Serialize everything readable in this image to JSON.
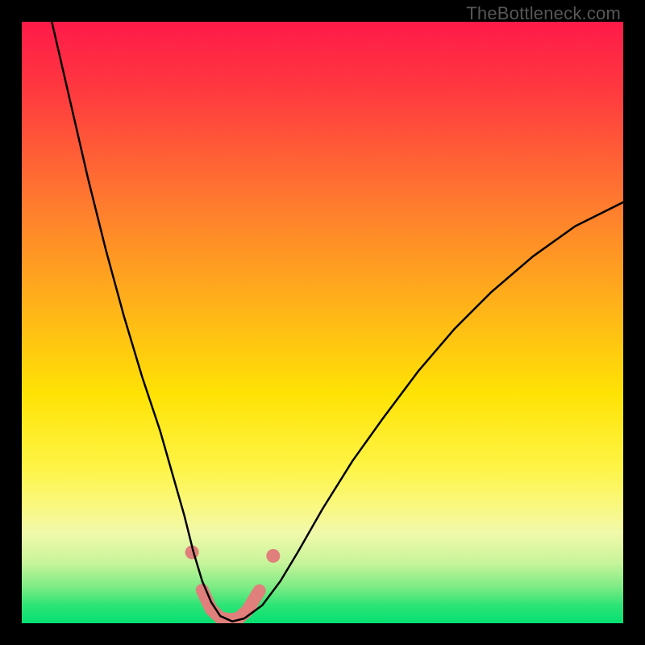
{
  "watermark": "TheBottleneck.com",
  "frame": {
    "outer_w": 800,
    "outer_h": 800,
    "inner_left": 27,
    "inner_top": 27,
    "inner_w": 746,
    "inner_h": 746
  },
  "gradient": {
    "stops": [
      {
        "pct": 0,
        "color": "#ff1a49"
      },
      {
        "pct": 12,
        "color": "#ff3b3f"
      },
      {
        "pct": 30,
        "color": "#ff7a2f"
      },
      {
        "pct": 48,
        "color": "#ffb518"
      },
      {
        "pct": 62,
        "color": "#ffe305"
      },
      {
        "pct": 74,
        "color": "#fef445"
      },
      {
        "pct": 80,
        "color": "#faf87a"
      },
      {
        "pct": 85,
        "color": "#f1f9ab"
      },
      {
        "pct": 90,
        "color": "#c7f49a"
      },
      {
        "pct": 94,
        "color": "#7ceb84"
      },
      {
        "pct": 97,
        "color": "#2de476"
      },
      {
        "pct": 100,
        "color": "#06df72"
      }
    ]
  },
  "chart_data": {
    "type": "line",
    "title": "",
    "xlabel": "",
    "ylabel": "",
    "xlim": [
      0,
      100
    ],
    "ylim": [
      0,
      100
    ],
    "series": [
      {
        "name": "bottleneck-curve",
        "stroke": "#000000",
        "stroke_width": 2.5,
        "x": [
          5,
          8,
          11,
          14,
          17,
          20,
          23,
          25,
          27,
          28.5,
          30,
          31.5,
          33,
          35,
          37,
          40,
          43,
          46,
          50,
          55,
          60,
          66,
          72,
          78,
          85,
          92,
          100
        ],
        "y": [
          100,
          87,
          74,
          62,
          51,
          41,
          32,
          25,
          18,
          12,
          7,
          3.5,
          1.2,
          0.3,
          0.8,
          3,
          7,
          12,
          19,
          27,
          34,
          42,
          49,
          55,
          61,
          66,
          70
        ]
      }
    ],
    "marker_path": {
      "name": "bottom-accent-path",
      "stroke": "#e07f7b",
      "stroke_width": 16,
      "linecap": "round",
      "x": [
        30,
        31.5,
        33,
        34.5,
        36,
        37.5,
        39.5
      ],
      "y": [
        5.5,
        2.3,
        0.9,
        0.6,
        0.8,
        2.1,
        5.4
      ]
    },
    "marker_dots": {
      "name": "accent-dots",
      "fill": "#e07f7b",
      "r": 8.5,
      "points": [
        {
          "x": 28.3,
          "y": 11.8
        },
        {
          "x": 41.8,
          "y": 11.2
        }
      ]
    }
  }
}
